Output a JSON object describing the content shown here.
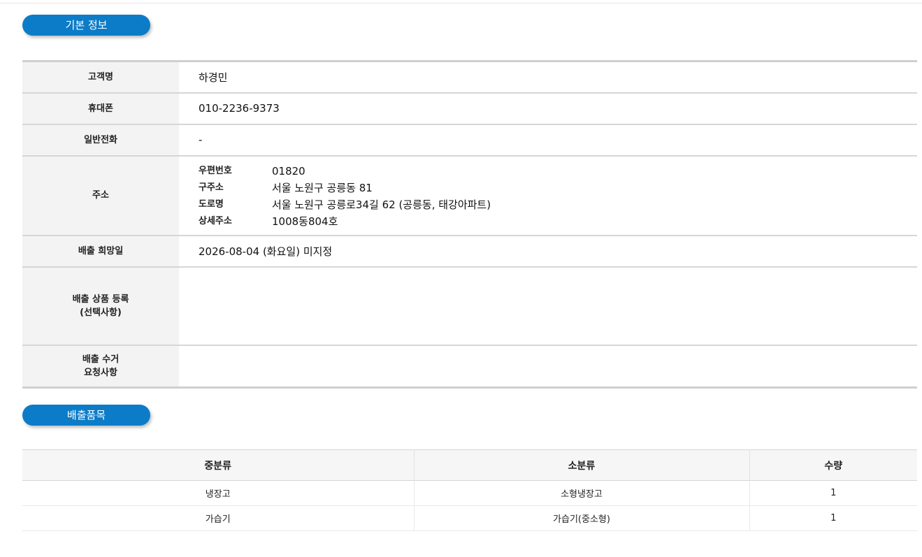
{
  "sections": {
    "basic_title": "기본 정보",
    "items_title": "배출품목"
  },
  "customer": {
    "name_label": "고객명",
    "name": "하경민",
    "mobile_label": "휴대폰",
    "mobile": "010-2236-9373",
    "phone_label": "일반전화",
    "phone": "-",
    "address_label": "주소",
    "address": {
      "zip_label": "우편번호",
      "zip": "01820",
      "old_label": "구주소",
      "old": "서울 노원구 공릉동 81",
      "road_label": "도로명",
      "road": "서울 노원구 공릉로34길 62 (공릉동, 태강아파트)",
      "detail_label": "상세주소",
      "detail": "1008동804호"
    },
    "date_label": "배출 희망일",
    "date": "2026-08-04 (화요일) 미지정",
    "goods_label_line1": "배출 상품 등록",
    "goods_label_line2": "(선택사항)",
    "goods": "",
    "request_label_line1": "배출 수거",
    "request_label_line2": "요청사항",
    "request": ""
  },
  "items": {
    "headers": [
      "중분류",
      "소분류",
      "수량"
    ],
    "rows": [
      [
        "냉장고",
        "소형냉장고",
        "1"
      ],
      [
        "가습기",
        "가습기(중소형)",
        "1"
      ]
    ]
  },
  "colors": {
    "accent": "#0c7cc8",
    "header_bg": "#f3f3f3"
  }
}
